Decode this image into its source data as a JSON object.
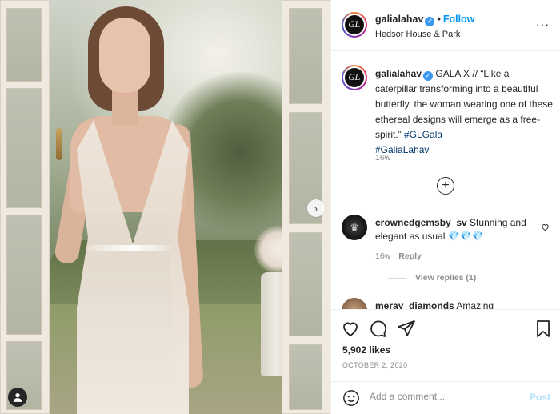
{
  "post": {
    "image_alt": "Model in sheer beaded wedding gown at garden doors",
    "carousel_next_icon": "chevron-right-icon",
    "tag_icon": "user-tag-icon"
  },
  "header": {
    "username": "galialahav",
    "verified_mark": "✓",
    "separator": "•",
    "follow_label": "Follow",
    "location": "Hedsor House & Park",
    "more": "···",
    "avatar_initials": "GL"
  },
  "caption": {
    "username": "galialahav",
    "text": " GALA X // “Like a caterpillar transforming into a beautiful butterfly, the woman wearing one of these ethereal designs will emerge as a free-spirit.” ",
    "hashtags": [
      "#GLGala",
      "#GaliaLahav"
    ],
    "time": "16w"
  },
  "comments": [
    {
      "username": "crownedgemsby_sv",
      "text": " Stunning and elegant as usual 💎💎💎",
      "time": "16w",
      "reply_label": "Reply",
      "view_replies": "View replies (1)"
    },
    {
      "username": "meray_diamonds",
      "text": " Amazing"
    }
  ],
  "actions": {
    "likes": "5,902 likes",
    "date": "OCTOBER 2, 2020"
  },
  "add_comment": {
    "placeholder": "Add a comment...",
    "post_label": "Post"
  },
  "colors": {
    "link_blue": "#0095f6",
    "hashtag": "#00376b",
    "muted": "#8e8e8e",
    "verified": "#3897f0"
  }
}
